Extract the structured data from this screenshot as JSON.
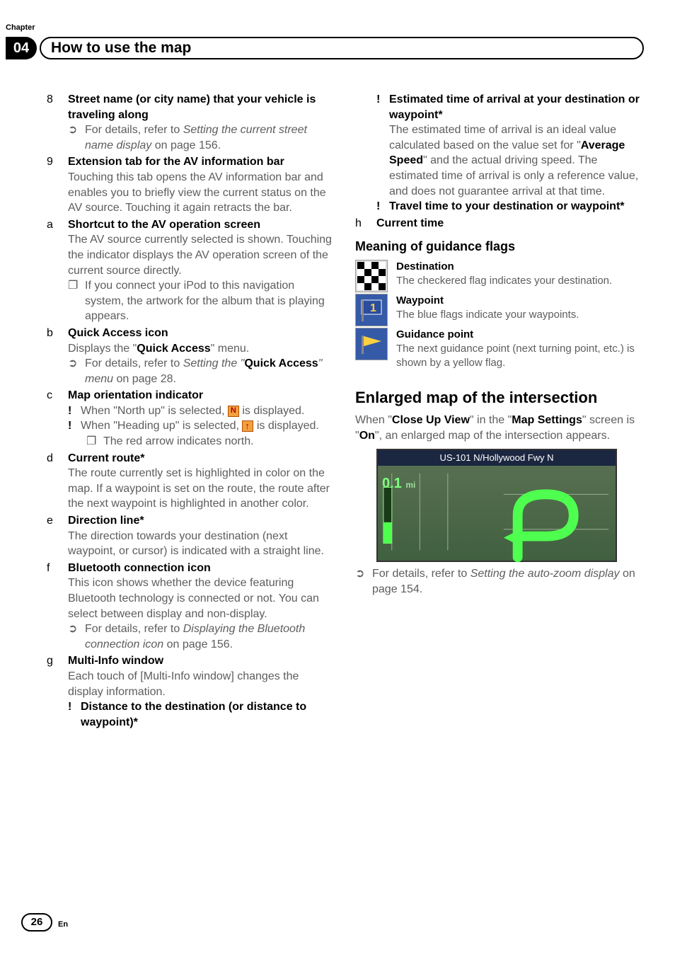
{
  "header": {
    "chapter_label": "Chapter",
    "chapter_number": "04",
    "title": "How to use the map"
  },
  "footer": {
    "page_number": "26",
    "lang": "En"
  },
  "items": {
    "i8": {
      "num": "8",
      "title": "Street name (or city name) that your vehicle is traveling along",
      "ref_pre": "For details, refer to ",
      "ref_ital": "Setting the current street name display",
      "ref_post": " on page 156."
    },
    "i9": {
      "num": "9",
      "title": "Extension tab for the AV information bar",
      "body": "Touching this tab opens the AV information bar and enables you to briefly view the current status on the AV source. Touching it again retracts the bar."
    },
    "i10": {
      "num": "a",
      "title": "Shortcut to the AV operation screen",
      "body": "The AV source currently selected is shown. Touching the indicator displays the AV operation screen of the current source directly.",
      "note": "If you connect your iPod to this navigation system, the artwork for the album that is playing appears."
    },
    "i11": {
      "num": "b",
      "title": "Quick Access icon",
      "body_pre": "Displays the \"",
      "body_bold": "Quick Access",
      "body_post": "\" menu.",
      "ref_pre": "For details, refer to ",
      "ref_ital_pre": "Setting the \"",
      "ref_bold": "Quick Access",
      "ref_ital_post": "\" menu",
      "ref_post": " on page 28."
    },
    "i12": {
      "num": "c",
      "title": "Map orientation indicator",
      "b1_pre": "When \"North up\" is selected, ",
      "b1_post": " is displayed.",
      "b2_pre": "When \"Heading up\" is selected, ",
      "b2_post": " is displayed.",
      "note": "The red arrow indicates north."
    },
    "i13": {
      "num": "d",
      "title": "Current route*",
      "body": "The route currently set is highlighted in color on the map. If a waypoint is set on the route, the route after the next waypoint is highlighted in another color."
    },
    "i14": {
      "num": "e",
      "title": "Direction line*",
      "body": "The direction towards your destination (next waypoint, or cursor) is indicated with a straight line."
    },
    "i15": {
      "num": "f",
      "title": "Bluetooth connection icon",
      "body": "This icon shows whether the device featuring Bluetooth technology is connected or not. You can select between display and non-display.",
      "ref_pre": "For details, refer to ",
      "ref_ital": "Displaying the Bluetooth connection icon",
      "ref_post": " on page 156."
    },
    "i16": {
      "num": "g",
      "title": "Multi-Info window",
      "body": "Each touch of [Multi-Info window] changes the display information.",
      "b1": "Distance to the destination (or distance to waypoint)*",
      "b2": "Estimated time of arrival at your destination or waypoint*",
      "b2_body_a": "The estimated time of arrival is an ideal value calculated based on the value set for \"",
      "b2_body_bold": "Average Speed",
      "b2_body_b": "\" and the actual driving speed. The estimated time of arrival is only a reference value, and does not guarantee arrival at that time.",
      "b3": "Travel time to your destination or waypoint*"
    },
    "i17": {
      "num": "h",
      "title": "Current time"
    }
  },
  "flags": {
    "heading": "Meaning of guidance flags",
    "dest": {
      "title": "Destination",
      "body": "The checkered flag indicates your destination."
    },
    "way": {
      "title": "Waypoint",
      "body": "The blue flags indicate your waypoints."
    },
    "guide": {
      "title": "Guidance point",
      "body": "The next guidance point (next turning point, etc.) is shown by a yellow flag."
    }
  },
  "enlarged": {
    "heading": "Enlarged map of the intersection",
    "para_a": "When \"",
    "para_b1": "Close Up View",
    "para_c": "\" in the \"",
    "para_b2": "Map Settings",
    "para_d": "\" screen is \"",
    "para_b3": "On",
    "para_e": "\", an enlarged map of the intersection appears.",
    "screenshot_road": "US-101 N/Hollywood Fwy N",
    "screenshot_dist": "0.1",
    "screenshot_unit": "mi",
    "ref_pre": "For details, refer to ",
    "ref_ital": "Setting the auto-zoom display",
    "ref_post": " on page 154."
  }
}
